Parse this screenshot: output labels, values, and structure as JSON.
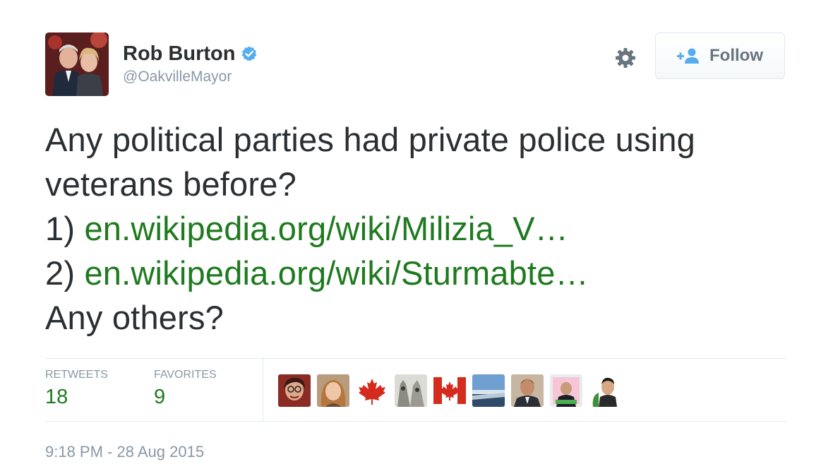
{
  "author": {
    "name": "Rob Burton",
    "handle": "@OakvilleMayor",
    "verified": true
  },
  "follow_button": {
    "label": "Follow"
  },
  "tweet": {
    "line1": "Any political parties had private police using",
    "line2": "veterans before?",
    "item1_prefix": "1) ",
    "item1_link": "en.wikipedia.org/wiki/Milizia_V…",
    "item2_prefix": "2) ",
    "item2_link": "en.wikipedia.org/wiki/Sturmabte…",
    "line5": "Any others?"
  },
  "stats": {
    "retweets_label": "RETWEETS",
    "retweets_value": "18",
    "favorites_label": "FAVORITES",
    "favorites_value": "9"
  },
  "favorited_by": [
    "user-avatar-1",
    "user-avatar-2",
    "maple-leaf-avatar",
    "owls-avatar",
    "canada-flag-avatar",
    "landscape-avatar",
    "user-avatar-3",
    "user-avatar-4",
    "user-avatar-5"
  ],
  "timestamp": "9:18 PM - 28 Aug 2015",
  "colors": {
    "link": "#1f7a1f",
    "verified": "#55acee",
    "muted": "#8899a6",
    "text": "#292f33"
  }
}
